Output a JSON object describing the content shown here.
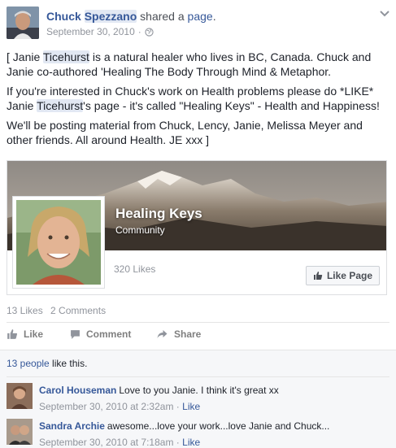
{
  "post": {
    "author_first": "Chuck",
    "author_last": "Spezzano",
    "action_text": "shared a",
    "page_word": "page",
    "trailing": ".",
    "timestamp": "September 30, 2010",
    "meta_sep": "·",
    "privacy_icon": "globe-icon",
    "paragraphs": {
      "p1_a": "[ Janie ",
      "p1_hl": "Ticehurst",
      "p1_b": " is a natural healer who lives in BC, Canada. Chuck and Janie co-authored 'Healing The Body Through Mind & Metaphor.",
      "p2_a": "If you're interested in Chuck's work on Health problems please do *LIKE* Janie ",
      "p2_hl": "Ticehurst",
      "p2_b": "'s page - it's called \"Healing Keys\" - Health and Happiness!",
      "p3": "We'll be posting material from Chuck, Lency, Janie, Melissa Meyer and other friends. All around Health. JE xxx ]"
    }
  },
  "share_card": {
    "title": "Healing Keys",
    "category": "Community",
    "likes": "320 Likes",
    "like_button": "Like Page"
  },
  "stats": {
    "likes": "13 Likes",
    "comments": "2 Comments"
  },
  "actions": {
    "like": "Like",
    "comment": "Comment",
    "share": "Share"
  },
  "likes_summary": {
    "people": "13 people",
    "rest": " like this."
  },
  "comments": [
    {
      "name": "Carol Houseman",
      "text": "Love to you Janie. I think it's great xx",
      "time": "September 30, 2010 at 2:32am",
      "sep": "·",
      "like": "Like"
    },
    {
      "name": "Sandra Archie",
      "text": "awesome...love your work...love Janie and Chuck...",
      "time": "September 30, 2010 at 7:18am",
      "sep": "·",
      "like": "Like"
    }
  ],
  "colors": {
    "link": "#365899",
    "muted": "#90949c",
    "highlight": "#e2e8f3"
  }
}
